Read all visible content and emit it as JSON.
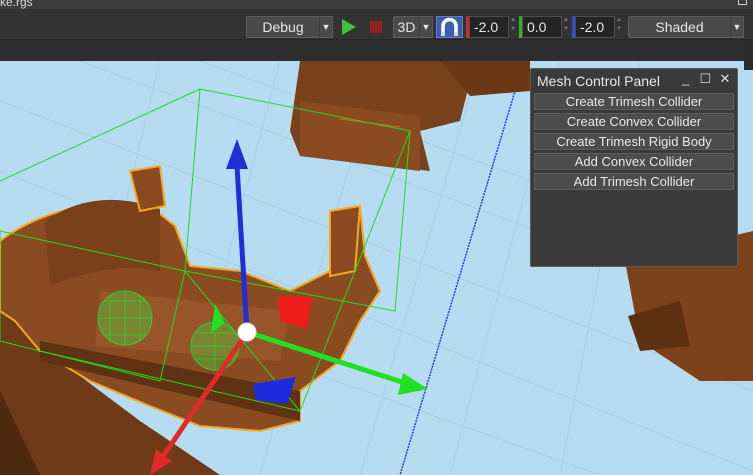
{
  "window": {
    "title": "ke.rgs"
  },
  "toolbar": {
    "build_config": "Debug",
    "view_mode": "3D",
    "x_value": "-2.0",
    "y_value": "0.0",
    "z_value": "-2.0",
    "shading": "Shaded",
    "icons": [
      "play-icon",
      "stop-icon",
      "magnet-icon"
    ],
    "colors": {
      "play": "#3ec23e",
      "stop": "#8b2323",
      "magnet": "#4a7bd8",
      "x_axis": "#cc2b2b",
      "y_axis": "#24b824",
      "z_axis": "#2d4fd6"
    }
  },
  "panel": {
    "title": "Mesh Control Panel",
    "buttons": [
      "Create Trimesh Collider",
      "Create Convex Collider",
      "Create Trimesh Rigid Body",
      "Add Convex Collider",
      "Add Trimesh Collider"
    ]
  }
}
